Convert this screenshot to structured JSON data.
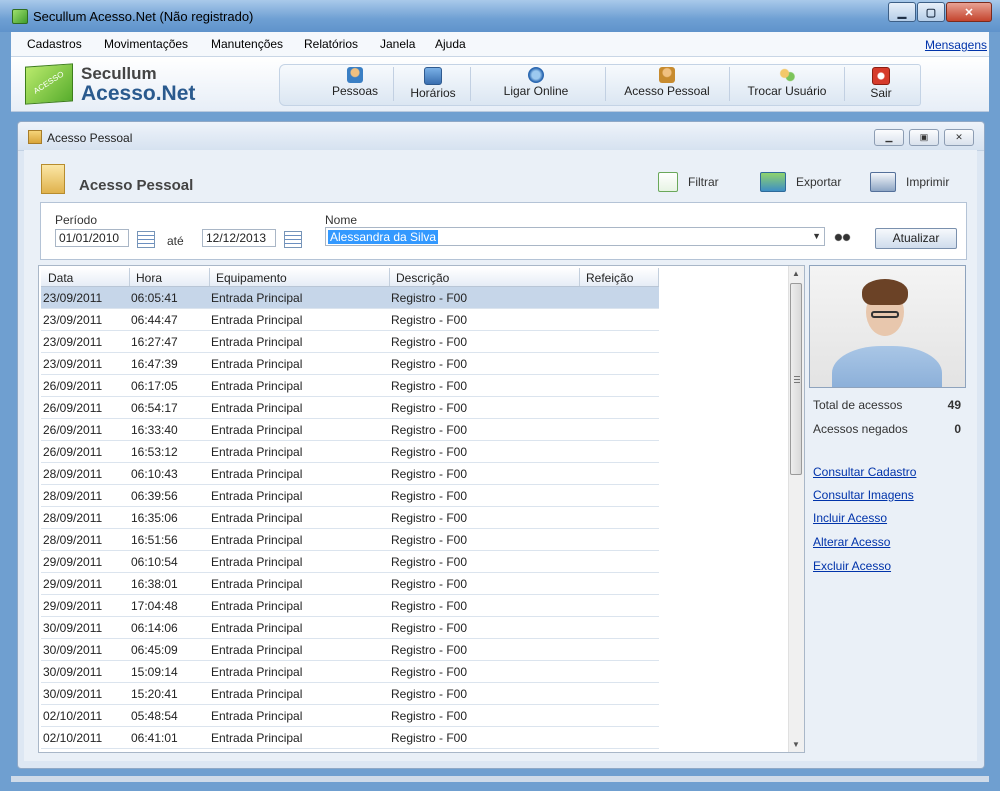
{
  "window": {
    "title": "Secullum Acesso.Net (Não registrado)"
  },
  "menu": {
    "items": [
      "Cadastros",
      "Movimentações",
      "Manutenções",
      "Relatórios",
      "Janela",
      "Ajuda"
    ],
    "messages": "Mensagens"
  },
  "brand": {
    "line1": "Secullum",
    "line2": "Acesso.Net",
    "logo_text": "ACESSO"
  },
  "toolbar": {
    "buttons": [
      "Pessoas",
      "Horários",
      "Ligar Online",
      "Acesso Pessoal",
      "Trocar Usuário",
      "Sair"
    ]
  },
  "child": {
    "title": "Acesso Pessoal",
    "header": "Acesso Pessoal",
    "actions": {
      "filter": "Filtrar",
      "export": "Exportar",
      "print": "Imprimir"
    }
  },
  "filters": {
    "period_label": "Período",
    "from": "01/01/2010",
    "until_label": "até",
    "to": "12/12/2013",
    "name_label": "Nome",
    "name": "Alessandra da Silva",
    "refresh": "Atualizar"
  },
  "grid": {
    "columns": [
      "Data",
      "Hora",
      "Equipamento",
      "Descrição",
      "Refeição"
    ],
    "rows": [
      [
        "23/09/2011",
        "06:05:41",
        "Entrada Principal",
        "Registro - F00",
        ""
      ],
      [
        "23/09/2011",
        "06:44:47",
        "Entrada Principal",
        "Registro - F00",
        ""
      ],
      [
        "23/09/2011",
        "16:27:47",
        "Entrada Principal",
        "Registro - F00",
        ""
      ],
      [
        "23/09/2011",
        "16:47:39",
        "Entrada Principal",
        "Registro - F00",
        ""
      ],
      [
        "26/09/2011",
        "06:17:05",
        "Entrada Principal",
        "Registro - F00",
        ""
      ],
      [
        "26/09/2011",
        "06:54:17",
        "Entrada Principal",
        "Registro - F00",
        ""
      ],
      [
        "26/09/2011",
        "16:33:40",
        "Entrada Principal",
        "Registro - F00",
        ""
      ],
      [
        "26/09/2011",
        "16:53:12",
        "Entrada Principal",
        "Registro - F00",
        ""
      ],
      [
        "28/09/2011",
        "06:10:43",
        "Entrada Principal",
        "Registro - F00",
        ""
      ],
      [
        "28/09/2011",
        "06:39:56",
        "Entrada Principal",
        "Registro - F00",
        ""
      ],
      [
        "28/09/2011",
        "16:35:06",
        "Entrada Principal",
        "Registro - F00",
        ""
      ],
      [
        "28/09/2011",
        "16:51:56",
        "Entrada Principal",
        "Registro - F00",
        ""
      ],
      [
        "29/09/2011",
        "06:10:54",
        "Entrada Principal",
        "Registro - F00",
        ""
      ],
      [
        "29/09/2011",
        "16:38:01",
        "Entrada Principal",
        "Registro - F00",
        ""
      ],
      [
        "29/09/2011",
        "17:04:48",
        "Entrada Principal",
        "Registro - F00",
        ""
      ],
      [
        "30/09/2011",
        "06:14:06",
        "Entrada Principal",
        "Registro - F00",
        ""
      ],
      [
        "30/09/2011",
        "06:45:09",
        "Entrada Principal",
        "Registro - F00",
        ""
      ],
      [
        "30/09/2011",
        "15:09:14",
        "Entrada Principal",
        "Registro - F00",
        ""
      ],
      [
        "30/09/2011",
        "15:20:41",
        "Entrada Principal",
        "Registro - F00",
        ""
      ],
      [
        "02/10/2011",
        "05:48:54",
        "Entrada Principal",
        "Registro - F00",
        ""
      ],
      [
        "02/10/2011",
        "06:41:01",
        "Entrada Principal",
        "Registro - F00",
        ""
      ]
    ],
    "selected_row": 0
  },
  "stats": {
    "total_label": "Total de acessos",
    "total": "49",
    "denied_label": "Acessos negados",
    "denied": "0"
  },
  "links": [
    "Consultar Cadastro",
    "Consultar Imagens",
    "Incluir Acesso",
    "Alterar Acesso",
    "Excluir Acesso"
  ],
  "colors": {
    "accent": "#3399ff",
    "selected_row": "#c6d6e9",
    "link": "#0033aa"
  }
}
